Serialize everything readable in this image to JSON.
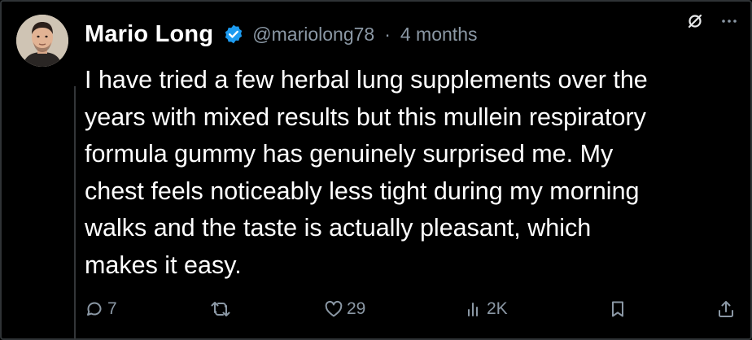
{
  "author": {
    "name": "Mario Long",
    "handle": "@mariolong78",
    "separator": "·",
    "timestamp": "4 months",
    "verified": true
  },
  "post": {
    "text": "I have tried a few herbal lung supplements over the\nyears with mixed results but this mullein respiratory\nformula gummy has genuinely surprised me. My\nchest feels noticeably less tight during my morning\nwalks and the taste is actually pleasant, which\nmakes it easy."
  },
  "header_icons": [
    "grok-icon",
    "more-icon"
  ],
  "actions": {
    "replies": "7",
    "reposts": "",
    "likes": "29",
    "views": "2K"
  },
  "colors": {
    "background": "#000000",
    "text": "#ffffff",
    "muted": "#8b98a5",
    "verified": "#1d9bf0",
    "border": "#2f3336"
  }
}
